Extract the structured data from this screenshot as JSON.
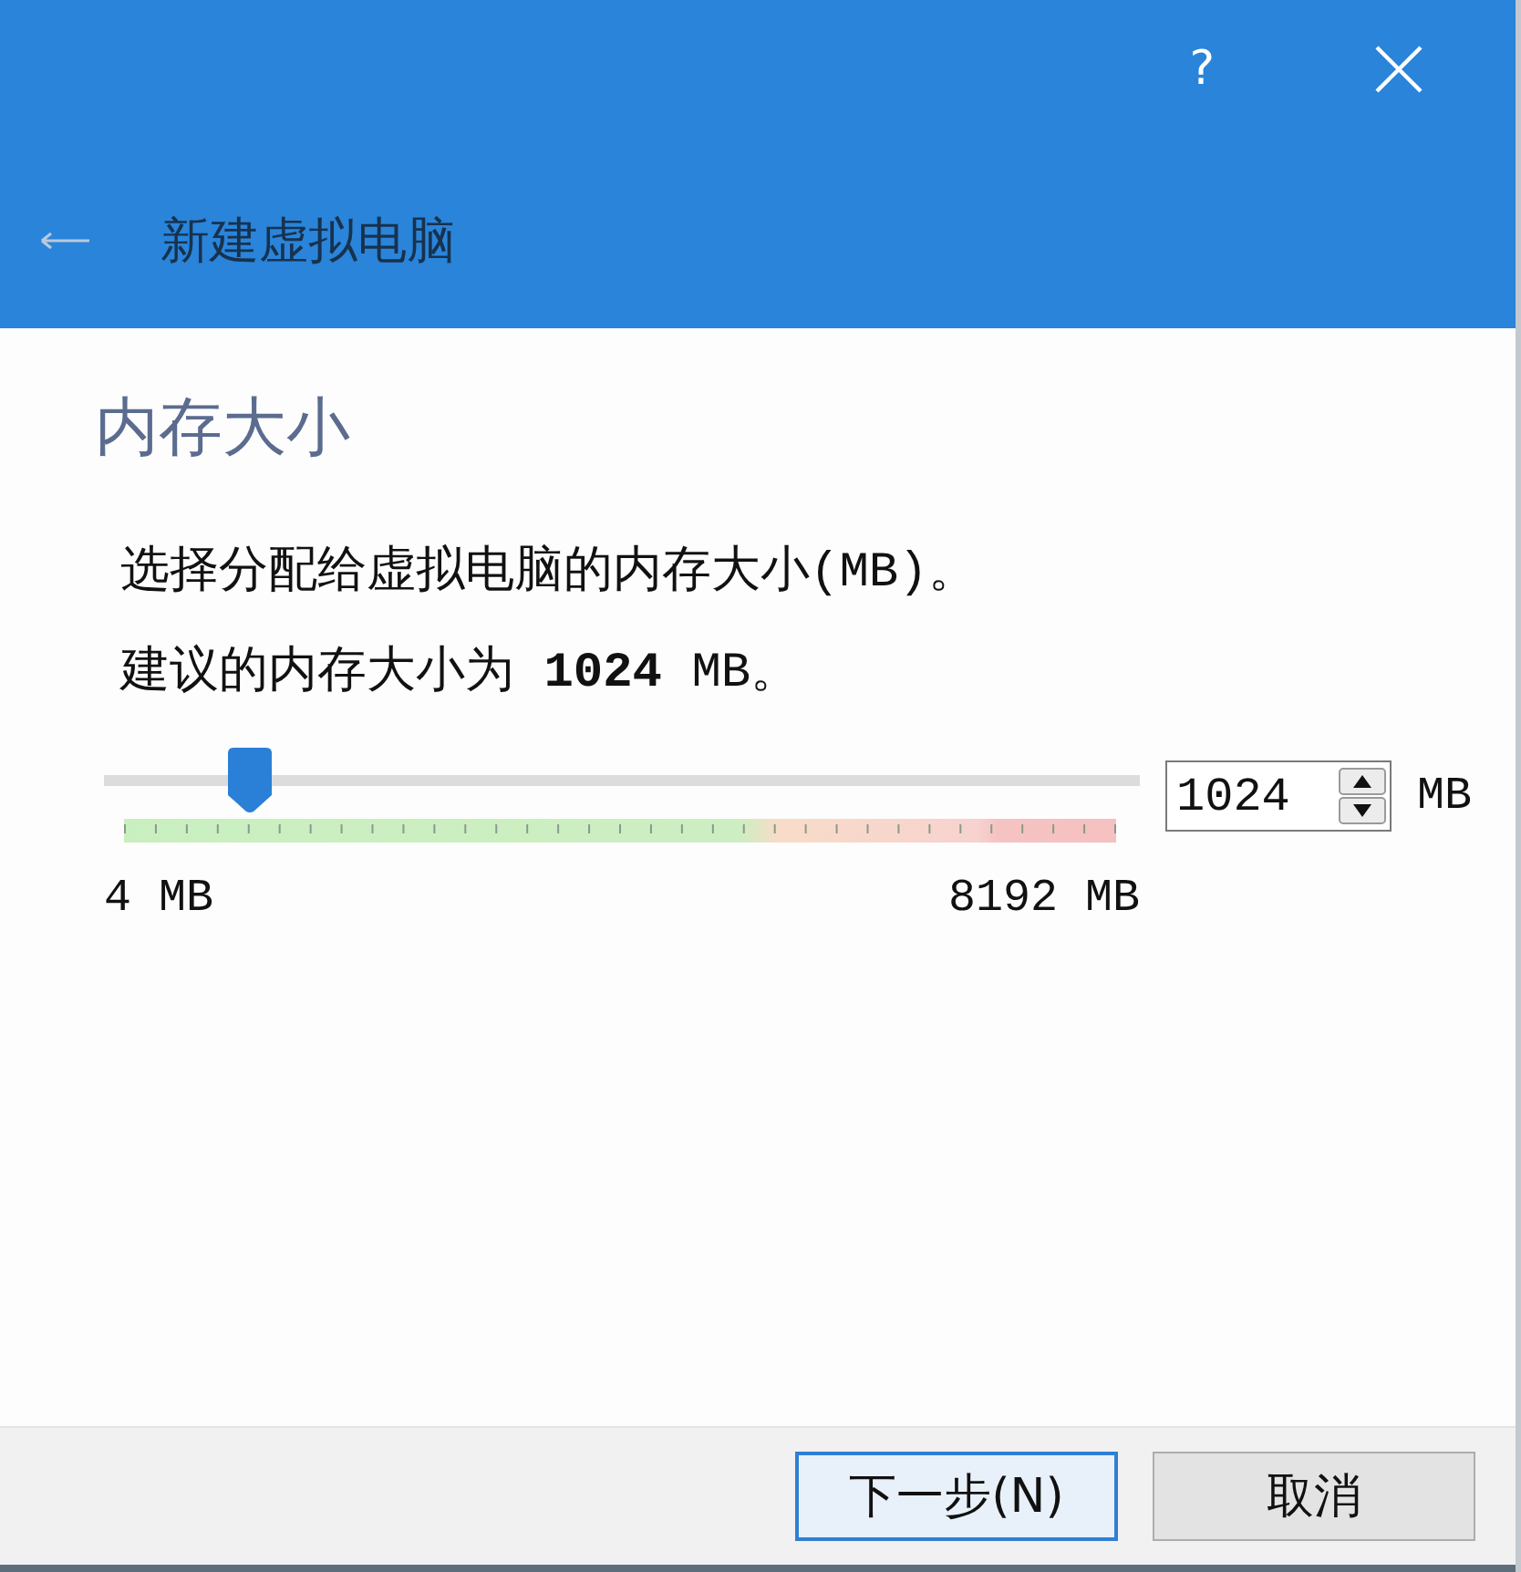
{
  "window": {
    "help": "?",
    "title": "新建虚拟电脑"
  },
  "page": {
    "heading": "内存大小",
    "description": "选择分配给虚拟电脑的内存大小(MB)。",
    "recommendation": "建议的内存大小为 **1024** MB。"
  },
  "memory": {
    "slider": {
      "level": 0.1246,
      "min_label": "4 MB",
      "max_label": "8192 MB"
    },
    "spinbox": {
      "value": "1024",
      "unit": "MB"
    }
  },
  "buttons": [
    {
      "label": "下一步(N)",
      "default": true
    },
    {
      "label": "取消",
      "default": false
    }
  ]
}
